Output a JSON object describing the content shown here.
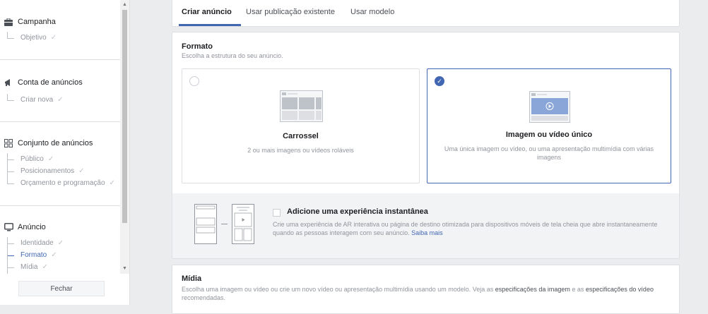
{
  "sidebar": {
    "sections": [
      {
        "title": "Campanha",
        "icon": "briefcase-icon",
        "items": [
          {
            "label": "Objetivo",
            "done": true
          }
        ]
      },
      {
        "title": "Conta de anúncios",
        "icon": "megaphone-icon",
        "items": [
          {
            "label": "Criar nova",
            "done": true
          }
        ]
      },
      {
        "title": "Conjunto de anúncios",
        "icon": "grid-icon",
        "items": [
          {
            "label": "Público",
            "done": true
          },
          {
            "label": "Posicionamentos",
            "done": true
          },
          {
            "label": "Orçamento e programação",
            "done": true
          }
        ]
      },
      {
        "title": "Anúncio",
        "icon": "monitor-icon",
        "items": [
          {
            "label": "Identidade",
            "done": true
          },
          {
            "label": "Formato",
            "done": true,
            "active": true
          },
          {
            "label": "Mídia",
            "done": true
          }
        ]
      }
    ],
    "close_label": "Fechar"
  },
  "tabs": [
    "Criar anúncio",
    "Usar publicação existente",
    "Usar modelo"
  ],
  "format": {
    "title": "Formato",
    "subtitle": "Escolha a estrutura do seu anúncio.",
    "options": [
      {
        "title": "Carrossel",
        "desc": "2 ou mais imagens ou vídeos roláveis",
        "selected": false
      },
      {
        "title": "Imagem ou vídeo único",
        "desc": "Uma única imagem ou vídeo, ou uma apresentação multimídia com várias imagens",
        "selected": true
      }
    ],
    "instant": {
      "title": "Adicione uma experiência instantânea",
      "desc": "Crie uma experiência de AR interativa ou página de destino otimizada para dispositivos móveis de tela cheia que abre instantaneamente quando as pessoas interagem com seu anúncio.",
      "link": "Saiba mais"
    }
  },
  "media": {
    "title": "Mídia",
    "desc_a": "Escolha uma imagem ou vídeo ou crie um novo vídeo ou apresentação multimídia usando um modelo. Veja as",
    "link_a": "especificações da imagem",
    "desc_b": "e as",
    "link_b": "especificações do vídeo",
    "desc_c": "recomendadas."
  },
  "colors": {
    "accent": "#4267b2",
    "muted": "#90949c"
  }
}
